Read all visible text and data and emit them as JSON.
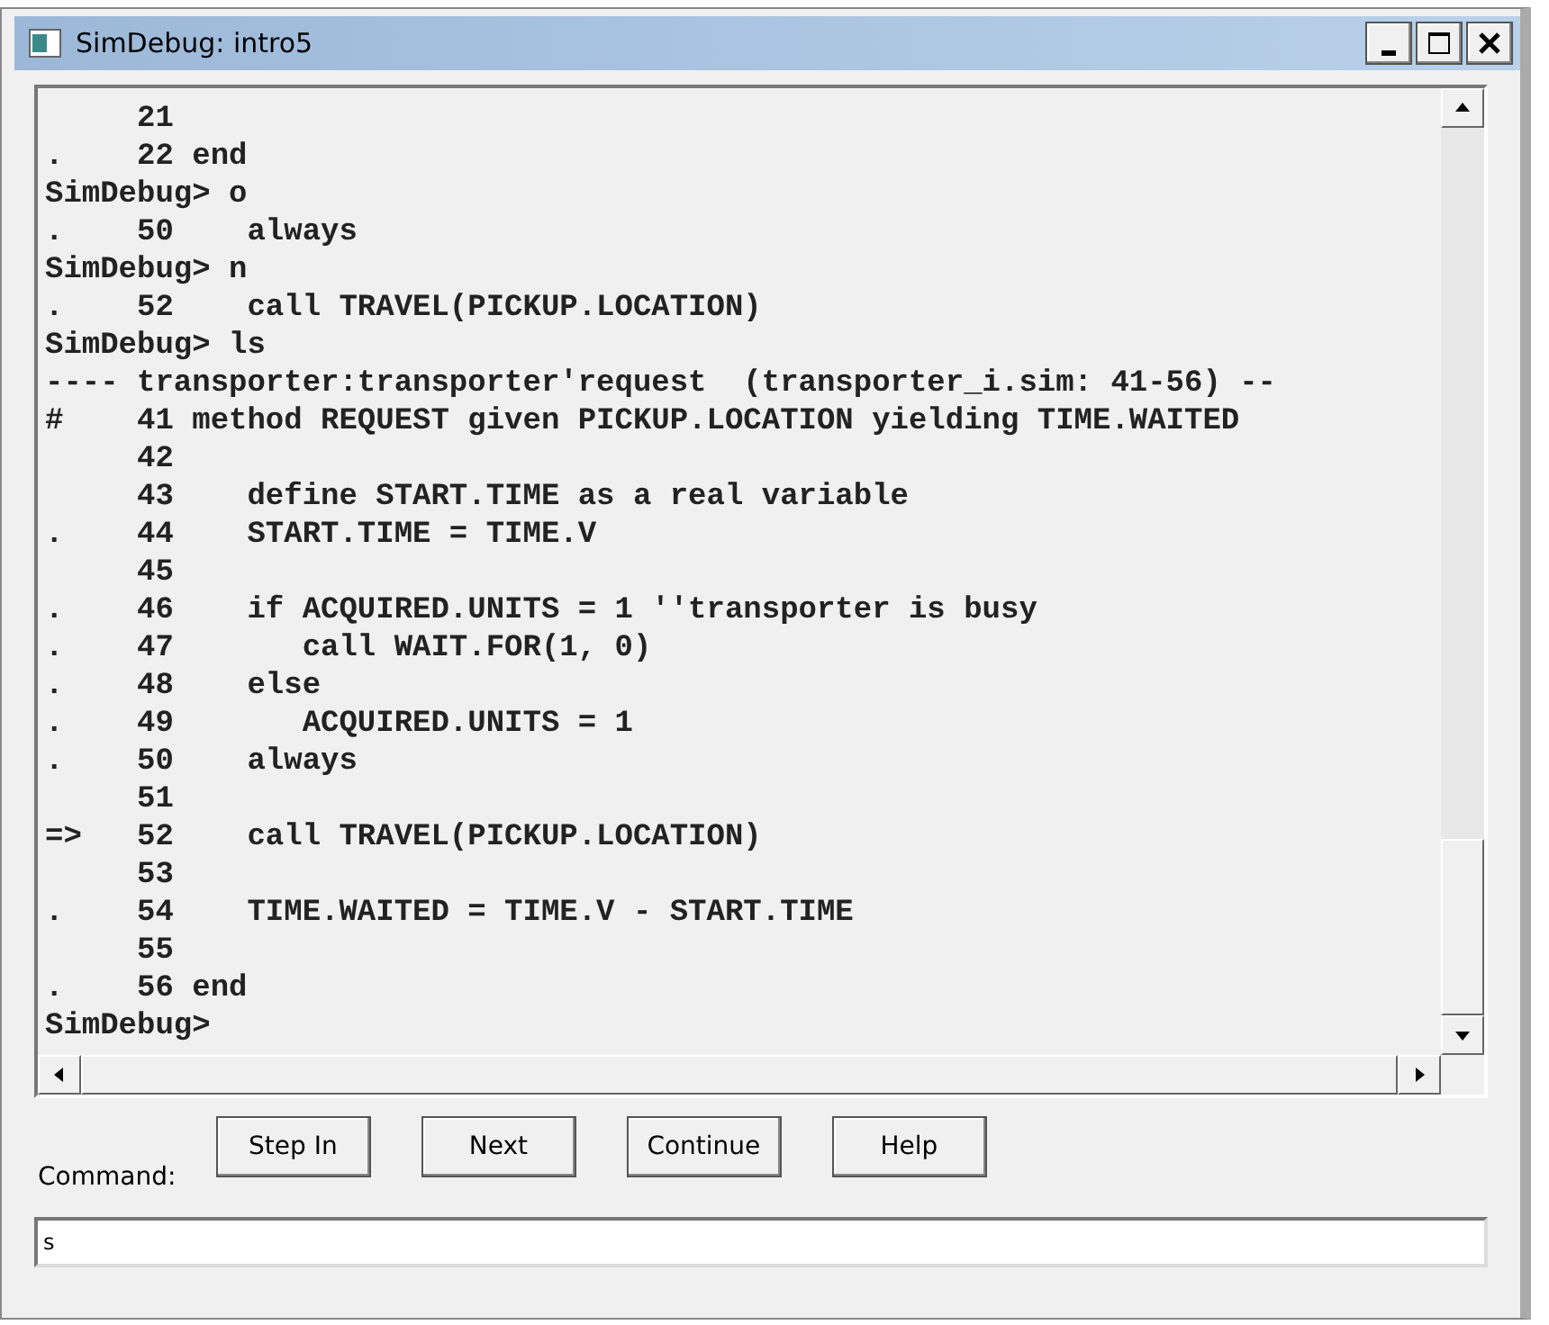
{
  "window": {
    "title": "SimDebug: intro5"
  },
  "console": {
    "lines": [
      "     21",
      ".    22 end",
      "SimDebug> o",
      ".    50    always",
      "SimDebug> n",
      ".    52    call TRAVEL(PICKUP.LOCATION)",
      "SimDebug> ls",
      "---- transporter:transporter'request  (transporter_i.sim: 41-56) --",
      "#    41 method REQUEST given PICKUP.LOCATION yielding TIME.WAITED",
      "     42",
      "     43    define START.TIME as a real variable",
      ".    44    START.TIME = TIME.V",
      "     45",
      ".    46    if ACQUIRED.UNITS = 1 ''transporter is busy",
      ".    47       call WAIT.FOR(1, 0)",
      ".    48    else",
      ".    49       ACQUIRED.UNITS = 1",
      ".    50    always",
      "     51",
      "=>   52    call TRAVEL(PICKUP.LOCATION)",
      "     53",
      ".    54    TIME.WAITED = TIME.V - START.TIME",
      "     55",
      ".    56 end",
      "SimDebug>"
    ]
  },
  "command": {
    "label": "Command:",
    "buttons": [
      "Step In",
      "Next",
      "Continue",
      "Help"
    ],
    "value": "s"
  }
}
